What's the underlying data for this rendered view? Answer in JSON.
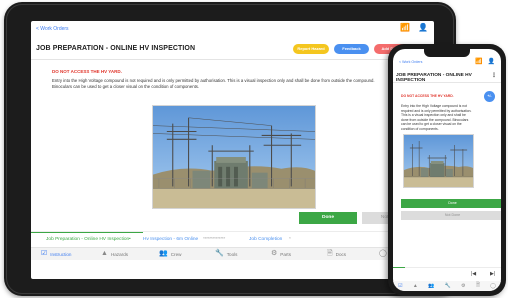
{
  "tablet": {
    "back_label": "< Work Orders",
    "title": "JOB PREPARATION - ONLINE HV INSPECTION",
    "buttons": {
      "report_hazard": "Report Hazard",
      "feedback": "Feedback",
      "add_defect": "Add Defect"
    },
    "warning": "DO NOT ACCESS THE HV YARD.",
    "body": "Entry into the High Voltage compound is not required and is only permitted by authorisation. This is a visual inspection only and shall be done from outside the compound. Binoculars can be used to get a closer visual on the condition of components.",
    "done_label": "Done",
    "not_done_label": "Not Done",
    "steps": [
      {
        "label": "Job Preparation - Online HV Inspection",
        "status": "complete"
      },
      {
        "label": "Hv Inspection - 6m Online",
        "status": "upcoming"
      },
      {
        "label": "Job Completion",
        "status": "upcoming"
      }
    ],
    "step_separators": [
      "•",
      "**************",
      "*"
    ],
    "skip_icon": "skip-next-icon",
    "skip_glyph": "⏭",
    "nav": [
      {
        "label": "Instruction",
        "icon": "checkbox-icon",
        "glyph": "☑",
        "active": true
      },
      {
        "label": "Hazards",
        "icon": "warning-icon",
        "glyph": "▲",
        "active": false
      },
      {
        "label": "Crew",
        "icon": "group-icon",
        "glyph": "👥",
        "active": false
      },
      {
        "label": "Tools",
        "icon": "wrench-icon",
        "glyph": "🔧",
        "active": false
      },
      {
        "label": "Parts",
        "icon": "gear-icon",
        "glyph": "⚙",
        "active": false
      },
      {
        "label": "Docs",
        "icon": "document-icon",
        "glyph": "🗎",
        "active": false
      },
      {
        "label": "",
        "icon": "bulb-icon",
        "glyph": "◯",
        "active": false
      }
    ],
    "status_icons": {
      "wifi_glyph": "📶",
      "user_glyph": "👤"
    }
  },
  "phone": {
    "back_label": "< Work Orders",
    "title": "JOB PREPARATION - ONLINE HV INSPECTION",
    "kebab_glyph": "⋮",
    "warning": "DO NOT ACCESS THE HV YARD.",
    "fab_label": "+/-",
    "body": "Entry into the High Voltage compound is not required and is only permitted by authorisation. This is a visual inspection only and shall be done from outside the compound. Binoculars can be used to get a closer visual on the condition of components.",
    "done_label": "Done",
    "not_done_label": "Not Done",
    "skip_glyphs": [
      "|◀",
      "▶|"
    ],
    "nav_glyphs": [
      "☑",
      "▲",
      "👥",
      "🔧",
      "⚙",
      "🗎",
      "◯"
    ],
    "status_icons": {
      "wifi_glyph": "📶",
      "user_glyph": "👤"
    }
  },
  "colors": {
    "accent_blue": "#3d7cf0",
    "done_green": "#3ca745",
    "warning_red": "#e0352b",
    "report_yellow": "#f4c61f",
    "feedback_blue": "#4a90f0",
    "add_defect_red": "#f46c6c"
  }
}
